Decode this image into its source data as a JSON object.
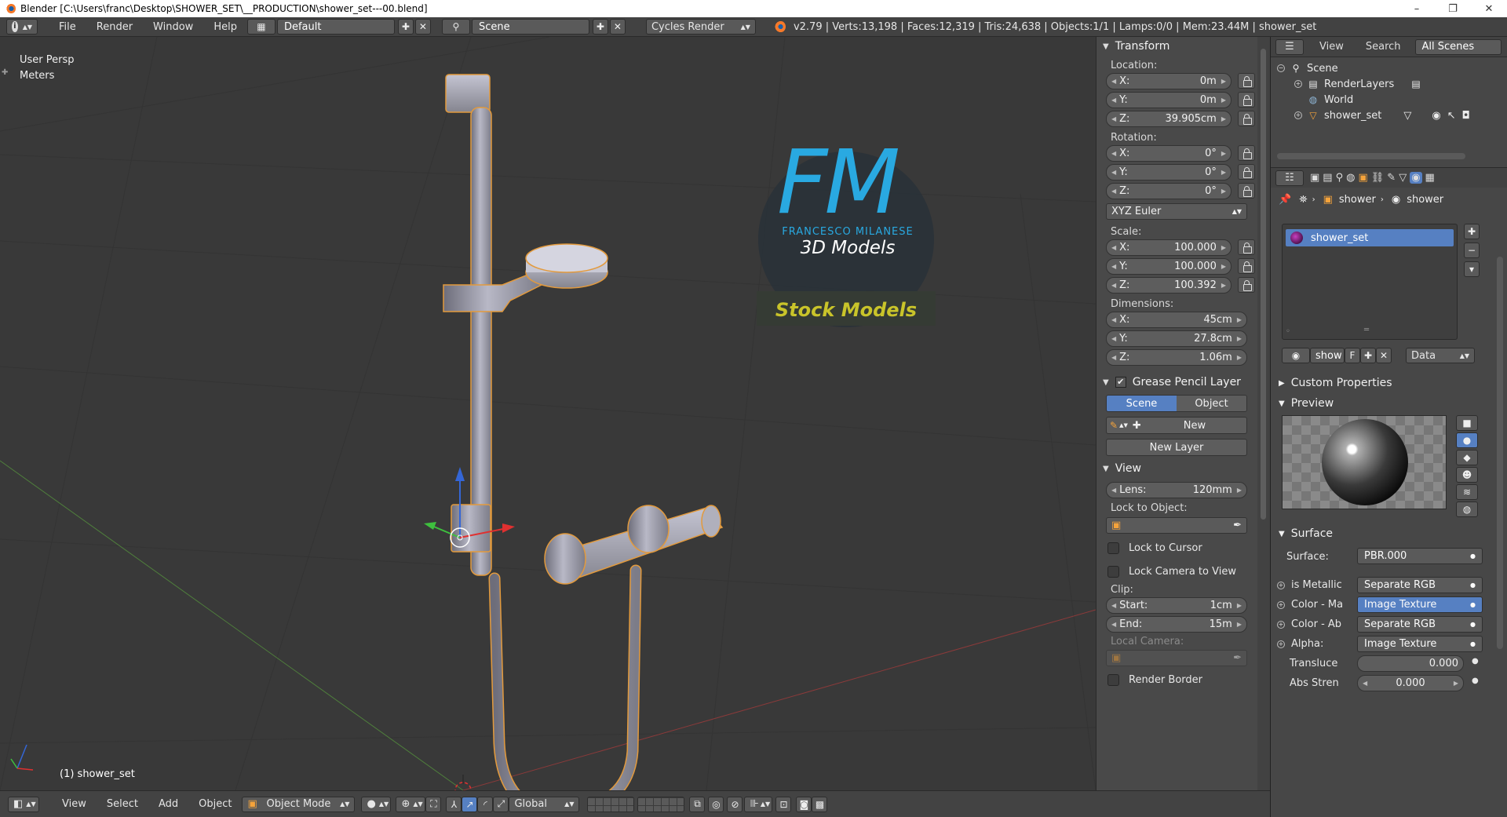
{
  "window": {
    "title": "Blender [C:\\Users\\franc\\Desktop\\SHOWER_SET\\__PRODUCTION\\shower_set---00.blend]",
    "minimize": "–",
    "maximize": "❐",
    "close": "✕"
  },
  "infobar": {
    "menus": [
      "File",
      "Render",
      "Window",
      "Help"
    ],
    "screen_layout": "Default",
    "scene": "Scene",
    "render_engine": "Cycles Render",
    "stats": "v2.79 | Verts:13,198 | Faces:12,319 | Tris:24,638 | Objects:1/1 | Lamps:0/0 | Mem:23.44M | shower_set"
  },
  "viewport": {
    "view_name": "User Persp",
    "units": "Meters",
    "object_label": "(1) shower_set",
    "watermark": {
      "logo_letters": "FM",
      "author": "FRANCESCO MILANESE",
      "subtitle": "3D Models",
      "banner": "Stock Models"
    }
  },
  "npanel": {
    "transform": {
      "header": "Transform",
      "location_label": "Location:",
      "location": [
        {
          "axis": "X:",
          "value": "0m"
        },
        {
          "axis": "Y:",
          "value": "0m"
        },
        {
          "axis": "Z:",
          "value": "39.905cm"
        }
      ],
      "rotation_label": "Rotation:",
      "rotation": [
        {
          "axis": "X:",
          "value": "0°"
        },
        {
          "axis": "Y:",
          "value": "0°"
        },
        {
          "axis": "Z:",
          "value": "0°"
        }
      ],
      "rotation_mode": "XYZ Euler",
      "scale_label": "Scale:",
      "scale": [
        {
          "axis": "X:",
          "value": "100.000"
        },
        {
          "axis": "Y:",
          "value": "100.000"
        },
        {
          "axis": "Z:",
          "value": "100.392"
        }
      ],
      "dimensions_label": "Dimensions:",
      "dimensions": [
        {
          "axis": "X:",
          "value": "45cm"
        },
        {
          "axis": "Y:",
          "value": "27.8cm"
        },
        {
          "axis": "Z:",
          "value": "1.06m"
        }
      ]
    },
    "grease_pencil": {
      "header": "Grease Pencil Layer",
      "tab_scene": "Scene",
      "tab_object": "Object",
      "new": "New",
      "new_layer": "New Layer"
    },
    "view": {
      "header": "View",
      "lens_label": "Lens:",
      "lens_value": "120mm",
      "lock_to_object": "Lock to Object:",
      "lock_to_cursor": "Lock to Cursor",
      "lock_camera": "Lock Camera to View",
      "clip_label": "Clip:",
      "clip_start_label": "Start:",
      "clip_start": "1cm",
      "clip_end_label": "End:",
      "clip_end": "15m",
      "local_camera": "Local Camera:",
      "render_border": "Render Border"
    }
  },
  "outliner": {
    "view": "View",
    "search": "Search",
    "filter": "All Scenes",
    "items": [
      "Scene",
      "RenderLayers",
      "World",
      "shower_set"
    ]
  },
  "properties": {
    "breadcrumb": [
      "shower",
      "shower"
    ],
    "material_slot": "shower_set",
    "material_name": "show",
    "fake_user": "F",
    "link": "Data",
    "custom_properties": "Custom Properties",
    "preview": "Preview",
    "surface_header": "Surface",
    "surface_label": "Surface:",
    "surface_value": "PBR.000",
    "inputs": [
      {
        "label": "is Metallic",
        "value": "Separate RGB"
      },
      {
        "label": "Color - Ma",
        "value": "Image Texture"
      },
      {
        "label": "Color - Ab",
        "value": "Separate RGB"
      },
      {
        "label": "Alpha:",
        "value": "Image Texture"
      }
    ],
    "translucency_label": "Transluce",
    "translucency_value": "0.000",
    "abs_strength_label": "Abs Stren",
    "abs_strength_value": "0.000"
  },
  "bottombar": {
    "menus": [
      "View",
      "Select",
      "Add",
      "Object"
    ],
    "mode": "Object Mode",
    "orientation": "Global"
  },
  "colors": {
    "selected_blue": "#5680c2",
    "accent_orange": "#f5a33b",
    "watermark_blue": "#29a9e1",
    "banner_yellow": "#c9c42a"
  }
}
